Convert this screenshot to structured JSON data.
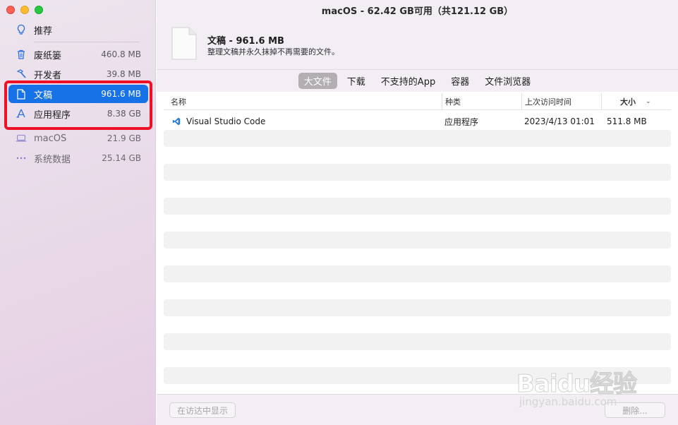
{
  "window": {
    "title": "macOS - 62.42 GB可用（共121.12 GB）"
  },
  "sidebar": {
    "items": [
      {
        "label": "推荐",
        "size": "",
        "icon": "lightbulb-icon"
      },
      {
        "label": "废纸篓",
        "size": "460.8 MB",
        "icon": "trash-icon"
      },
      {
        "label": "开发者",
        "size": "39.8 MB",
        "icon": "hammer-icon"
      },
      {
        "label": "文稿",
        "size": "961.6 MB",
        "icon": "document-icon",
        "selected": true
      },
      {
        "label": "应用程序",
        "size": "8.38 GB",
        "icon": "app-store-icon"
      },
      {
        "label": "macOS",
        "size": "21.9 GB",
        "icon": "laptop-icon"
      },
      {
        "label": "系统数据",
        "size": "25.14 GB",
        "icon": "ellipsis-icon"
      }
    ]
  },
  "header": {
    "title": "文稿 - 961.6 MB",
    "subtitle": "整理文稿并永久抹掉不再需要的文件。"
  },
  "tabs": [
    {
      "label": "大文件",
      "active": true
    },
    {
      "label": "下载",
      "active": false
    },
    {
      "label": "不支持的App",
      "active": false
    },
    {
      "label": "容器",
      "active": false
    },
    {
      "label": "文件浏览器",
      "active": false
    }
  ],
  "table": {
    "columns": [
      "名称",
      "种类",
      "上次访问时间",
      "大小"
    ],
    "rows": [
      {
        "name": "Visual Studio Code",
        "kind": "应用程序",
        "accessed": "2023/4/13 01:01",
        "size": "511.8 MB",
        "icon": "vscode-icon"
      }
    ]
  },
  "footer": {
    "show_in_finder": "在访达中显示",
    "delete": "删除..."
  },
  "watermark": {
    "brand": "Baidu经验",
    "url": "jingyan.baidu.com"
  },
  "colors": {
    "accent": "#1672e6",
    "annotation": "#ee1026"
  }
}
